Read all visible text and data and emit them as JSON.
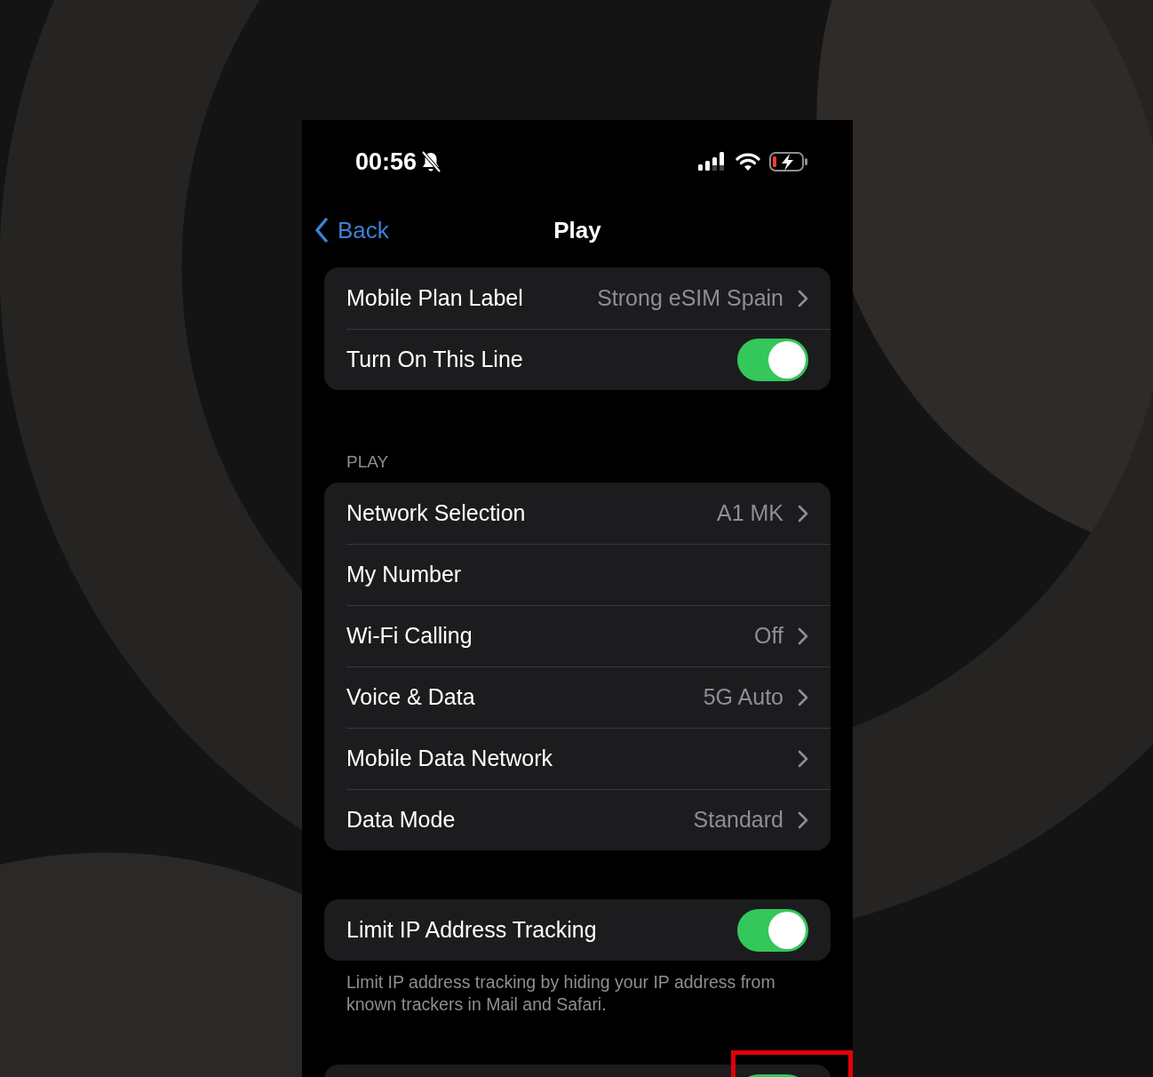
{
  "status_bar": {
    "time": "00:56"
  },
  "nav": {
    "back": "Back",
    "title": "Play"
  },
  "sections": [
    {
      "rows": [
        {
          "kind": "link",
          "label": "Mobile Plan Label",
          "value": "Strong eSIM Spain"
        },
        {
          "kind": "toggle",
          "label": "Turn On This Line",
          "on": true
        }
      ]
    },
    {
      "header": "PLAY",
      "rows": [
        {
          "kind": "link",
          "label": "Network Selection",
          "value": "A1 MK"
        },
        {
          "kind": "plain",
          "label": "My Number"
        },
        {
          "kind": "link",
          "label": "Wi-Fi Calling",
          "value": "Off"
        },
        {
          "kind": "link",
          "label": "Voice & Data",
          "value": "5G Auto"
        },
        {
          "kind": "link",
          "label": "Mobile Data Network"
        },
        {
          "kind": "link",
          "label": "Data Mode",
          "value": "Standard"
        }
      ]
    },
    {
      "footer": "Limit IP address tracking by hiding your IP address from known trackers in Mail and Safari.",
      "rows": [
        {
          "kind": "toggle",
          "label": "Limit IP Address Tracking",
          "on": true
        }
      ]
    },
    {
      "rows": [
        {
          "kind": "toggle",
          "on": true,
          "highlighted": true
        }
      ]
    }
  ]
}
